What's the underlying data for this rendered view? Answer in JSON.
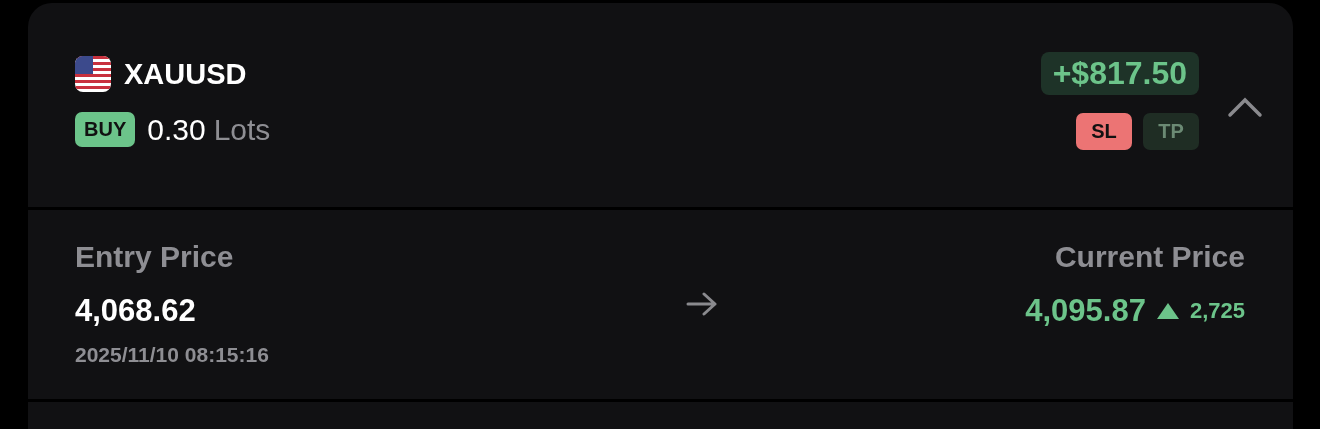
{
  "position": {
    "symbol": "XAUUSD",
    "side": {
      "label": "BUY",
      "kind": "buy"
    },
    "volume": "0.30",
    "volume_unit": "Lots",
    "profit": {
      "text": "+$817.50",
      "kind": "gain"
    },
    "orders": [
      {
        "label": "SL",
        "kind": "sl",
        "on": true
      },
      {
        "label": "TP",
        "kind": "tp",
        "on": false
      }
    ],
    "expanded": true
  },
  "details": {
    "entry": {
      "label": "Entry Price",
      "value": "4,068.62",
      "time": "2025/11/10 08:15:16"
    },
    "current": {
      "label": "Current Price",
      "value": "4,095.87",
      "rising": true,
      "change": "2,725"
    }
  }
}
